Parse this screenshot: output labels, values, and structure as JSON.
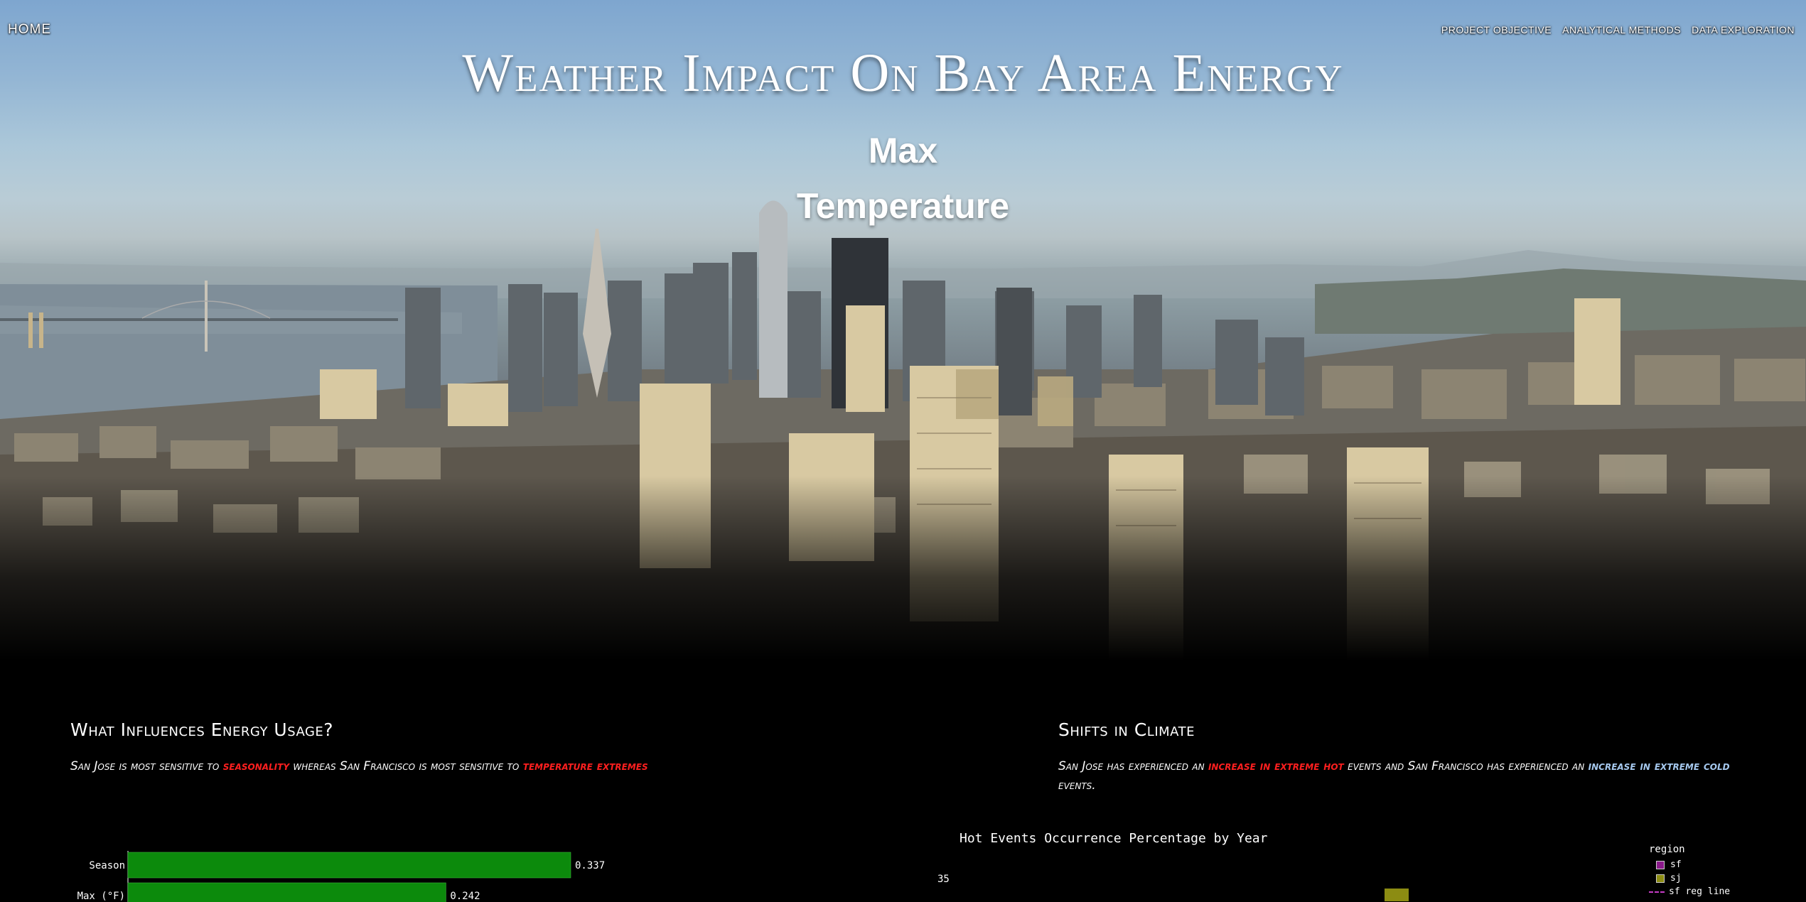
{
  "nav": {
    "home_label": "HOME",
    "links": [
      "PROJECT OBJECTIVE",
      "ANALYTICAL METHODS",
      "DATA EXPLORATION"
    ]
  },
  "hero": {
    "title": "Weather Impact On Bay Area Energy",
    "subtitle_line1": "Max",
    "subtitle_line2": "Temperature"
  },
  "influences": {
    "heading": "What Influences Energy Usage?",
    "text_a": "San Jose is most sensitive to ",
    "highlight_a": "seasonality",
    "text_b": " whereas San Francisco is most sensitive to ",
    "highlight_b": "temperature extremes"
  },
  "climate": {
    "heading": "Shifts in Climate",
    "text_a": "San Jose has experienced an ",
    "highlight_a": "increase in extreme hot",
    "text_b": " events and San Francisco has experienced an ",
    "highlight_b": "increase in extreme cold",
    "text_c": " events."
  },
  "chart_data": [
    {
      "type": "bar",
      "orientation": "horizontal",
      "categories": [
        "Season",
        "Max (°F)"
      ],
      "values": [
        0.337,
        0.242
      ],
      "value_labels": [
        "0.337",
        "0.242"
      ],
      "color": "#0c8a0c"
    },
    {
      "type": "bar",
      "title": "Hot Events Occurrence Percentage by Year",
      "y_tick_visible": "35",
      "legend_title": "region",
      "legend_position": "top-right",
      "legend": [
        {
          "label": "sf",
          "color": "#8b1a8b",
          "kind": "square"
        },
        {
          "label": "sj",
          "color": "#8c8c12",
          "kind": "square"
        },
        {
          "label": "sf reg line",
          "color": "#c63cc6",
          "kind": "dashed-line"
        }
      ]
    }
  ]
}
